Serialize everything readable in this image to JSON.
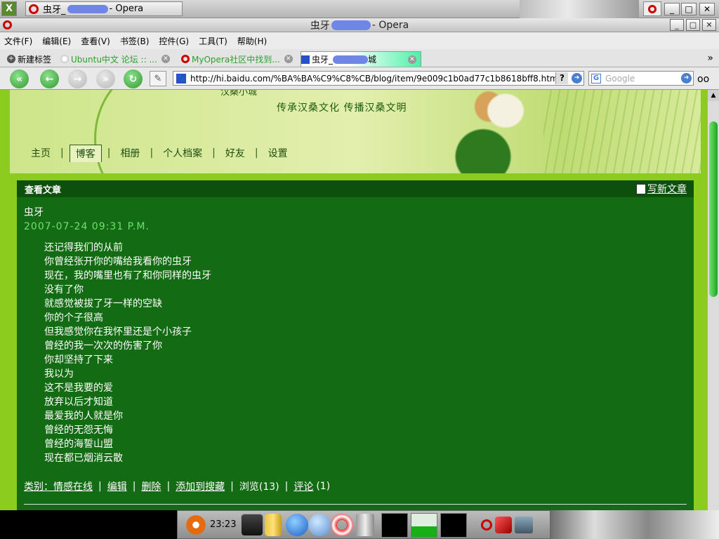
{
  "taskbar": {
    "task_title_prefix": "虫牙_",
    "task_title_suffix": " - Opera"
  },
  "window": {
    "title_prefix": "虫牙",
    "title_suffix": " - Opera",
    "controls": {
      "minimize": "_",
      "maximize": "□",
      "close": "✕"
    }
  },
  "menubar": {
    "items": [
      "文件(F)",
      "编辑(E)",
      "查看(V)",
      "书签(B)",
      "控件(G)",
      "工具(T)",
      "帮助(H)"
    ]
  },
  "tabs": {
    "new_tab": "新建标签",
    "items": [
      {
        "label": "Ubuntu中文 论坛 :: ..."
      },
      {
        "label": "MyOpera社区中找到..."
      },
      {
        "label_prefix": "虫牙_",
        "label_suffix": "城"
      }
    ],
    "more": "»"
  },
  "toolbar": {
    "url": "http://hi.baidu.com/%BA%BA%C9%C8%CB/blog/item/9e009c1b0ad77c1b8618bff8.html",
    "search_placeholder": "Google"
  },
  "banner": {
    "clipped_title": "汉桑小城",
    "slogan": "传承汉桑文化  传播汉桑文明",
    "nav": [
      "主页",
      "博客",
      "相册",
      "个人档案",
      "好友",
      "设置"
    ],
    "active_nav_index": 1
  },
  "article": {
    "section_title": "查看文章",
    "write_label": "写新文章",
    "author": "虫牙",
    "date": "2007-07-24 09:31 P.M.",
    "lines": [
      "还记得我们的从前",
      "你曾经张开你的嘴给我看你的虫牙",
      "现在，我的嘴里也有了和你同样的虫牙",
      "没有了你",
      "就感觉被拔了牙一样的空缺",
      "你的个子很高",
      "但我感觉你在我怀里还是个小孩子",
      "曾经的我一次次的伤害了你",
      "你却坚持了下来",
      "我以为",
      "这不是我要的爱",
      "放弃以后才知道",
      "最爱我的人就是你",
      "曾经的无怨无悔",
      "曾经的海誓山盟",
      "现在都已烟消云散"
    ],
    "footer": {
      "category": "类别：情感在线",
      "edit": "编辑",
      "delete": "删除",
      "add_fav": "添加到搜藏",
      "views": "浏览(13)",
      "comments_label": "评论",
      "comments_count": "(1)"
    }
  },
  "dock": {
    "clock": "23:23"
  },
  "colors": {
    "page_bg": "#8ccc1e",
    "content_bg": "#136b13",
    "header_bg": "#0d4f0d",
    "date_color": "#6fe06f"
  }
}
